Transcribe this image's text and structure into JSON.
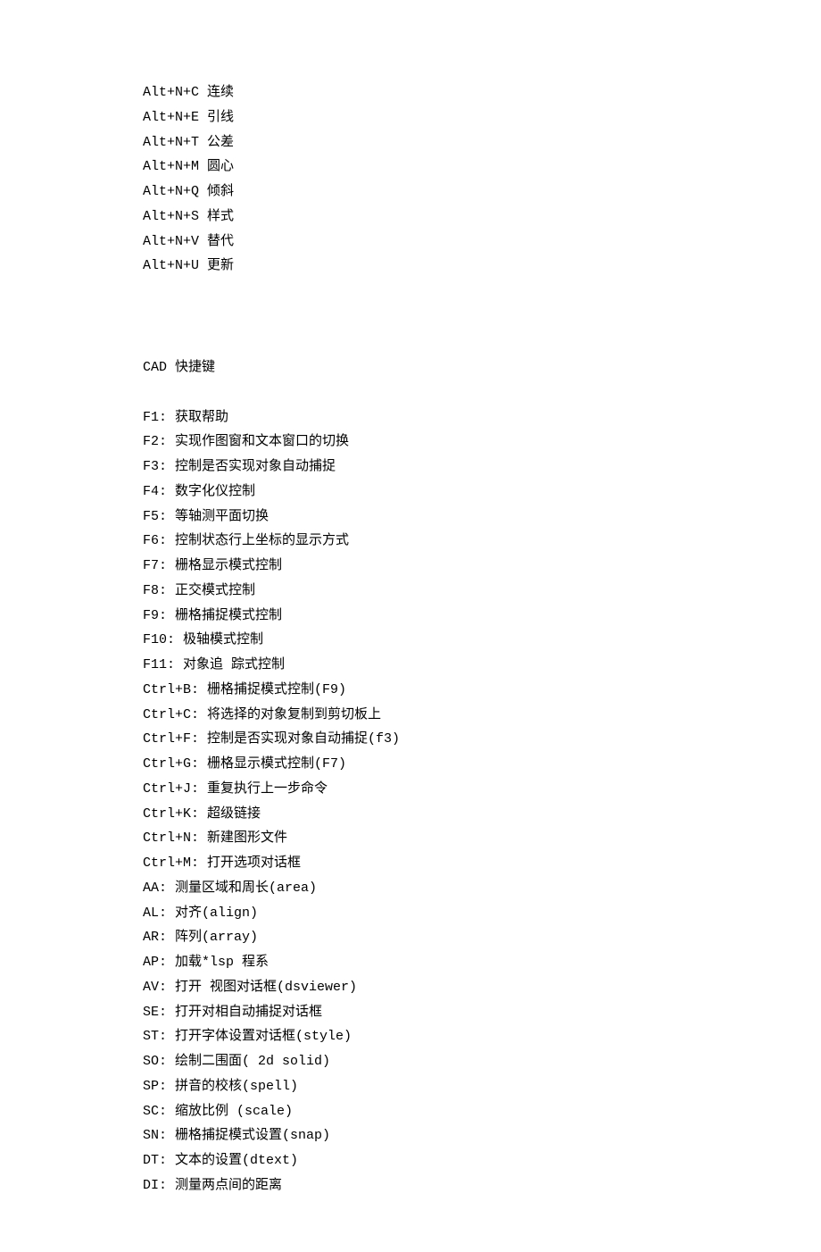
{
  "section1": [
    "Alt+N+C 连续",
    "Alt+N+E 引线",
    "Alt+N+T 公差",
    "Alt+N+M 圆心",
    "Alt+N+Q 倾斜",
    "Alt+N+S 样式",
    "Alt+N+V 替代",
    "Alt+N+U 更新"
  ],
  "heading": "CAD 快捷键",
  "section2": [
    "F1: 获取帮助",
    "F2: 实现作图窗和文本窗口的切换",
    "F3: 控制是否实现对象自动捕捉",
    "F4: 数字化仪控制",
    "F5: 等轴测平面切换",
    "F6: 控制状态行上坐标的显示方式",
    "F7: 栅格显示模式控制",
    "F8: 正交模式控制",
    "F9: 栅格捕捉模式控制",
    "F10: 极轴模式控制",
    "F11: 对象追 踪式控制",
    "Ctrl+B: 栅格捕捉模式控制(F9)",
    "Ctrl+C: 将选择的对象复制到剪切板上",
    "Ctrl+F: 控制是否实现对象自动捕捉(f3)",
    "Ctrl+G: 栅格显示模式控制(F7)",
    "Ctrl+J: 重复执行上一步命令",
    "Ctrl+K: 超级链接",
    "Ctrl+N: 新建图形文件",
    "Ctrl+M: 打开选项对话框",
    "AA: 测量区域和周长(area)",
    "AL: 对齐(align)",
    "AR: 阵列(array)",
    "AP: 加载*lsp 程系",
    "AV: 打开 视图对话框(dsviewer)",
    "SE: 打开对相自动捕捉对话框",
    "ST: 打开字体设置对话框(style)",
    "SO: 绘制二围面( 2d solid)",
    "SP: 拼音的校核(spell)",
    "SC: 缩放比例 (scale)",
    "SN: 栅格捕捉模式设置(snap)",
    "DT: 文本的设置(dtext)",
    "DI: 测量两点间的距离"
  ]
}
